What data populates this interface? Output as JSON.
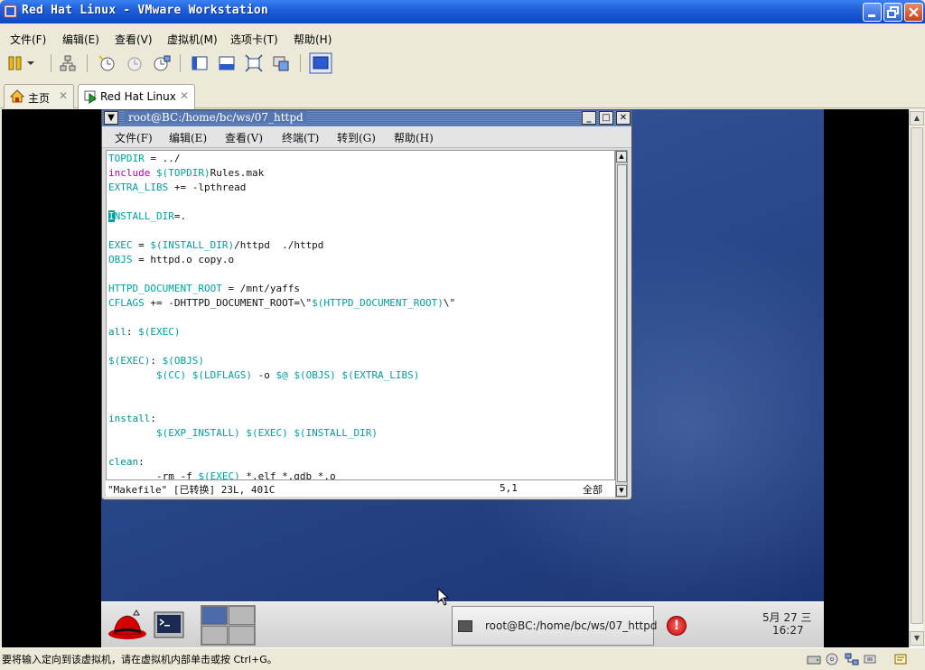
{
  "window": {
    "title": "Red Hat Linux - VMware Workstation"
  },
  "menubar": {
    "items": [
      "文件(F)",
      "编辑(E)",
      "查看(V)",
      "虚拟机(M)",
      "选项卡(T)",
      "帮助(H)"
    ]
  },
  "tabs": [
    {
      "label": "主页",
      "close": "✕"
    },
    {
      "label": "Red Hat Linux",
      "close": "✕"
    }
  ],
  "terminal": {
    "title": "root@BC:/home/bc/ws/07_httpd",
    "menu": [
      "文件(F)",
      "编辑(E)",
      "查看(V)",
      "终端(T)",
      "转到(G)",
      "帮助(H)"
    ],
    "lines": [
      [
        {
          "t": "TOPDIR",
          "c": "c-var"
        },
        {
          "t": " = ../"
        }
      ],
      [
        {
          "t": "include",
          "c": "c-kw"
        },
        {
          "t": " $(TOPDIR)",
          "c": "c-var"
        },
        {
          "t": "Rules.mak"
        }
      ],
      [
        {
          "t": "EXTRA_LIBS",
          "c": "c-var"
        },
        {
          "t": " += -lpthread"
        }
      ],
      [],
      [
        {
          "t": "I",
          "c": "cursor"
        },
        {
          "t": "NSTALL_DIR",
          "c": "c-var"
        },
        {
          "t": "=."
        }
      ],
      [],
      [
        {
          "t": "EXEC",
          "c": "c-var"
        },
        {
          "t": " = "
        },
        {
          "t": "$(INSTALL_DIR)",
          "c": "c-var"
        },
        {
          "t": "/httpd  ./httpd"
        }
      ],
      [
        {
          "t": "OBJS",
          "c": "c-var"
        },
        {
          "t": " = httpd.o copy.o"
        }
      ],
      [],
      [
        {
          "t": "HTTPD_DOCUMENT_ROOT",
          "c": "c-var"
        },
        {
          "t": " = /mnt/yaffs"
        }
      ],
      [
        {
          "t": "CFLAGS",
          "c": "c-var"
        },
        {
          "t": " += -DHTTPD_DOCUMENT_ROOT=\\\""
        },
        {
          "t": "$(HTTPD_DOCUMENT_ROOT)",
          "c": "c-var"
        },
        {
          "t": "\\\""
        }
      ],
      [],
      [
        {
          "t": "all",
          "c": "c-tgt"
        },
        {
          "t": ": "
        },
        {
          "t": "$(EXEC)",
          "c": "c-var"
        }
      ],
      [],
      [
        {
          "t": "$(EXEC)",
          "c": "c-var"
        },
        {
          "t": ": "
        },
        {
          "t": "$(OBJS)",
          "c": "c-var"
        }
      ],
      [
        {
          "t": "        "
        },
        {
          "t": "$(CC)",
          "c": "c-var"
        },
        {
          "t": " "
        },
        {
          "t": "$(LDFLAGS)",
          "c": "c-var"
        },
        {
          "t": " -o "
        },
        {
          "t": "$@",
          "c": "c-var"
        },
        {
          "t": " "
        },
        {
          "t": "$(OBJS)",
          "c": "c-var"
        },
        {
          "t": " "
        },
        {
          "t": "$(EXTRA_LIBS)",
          "c": "c-var"
        }
      ],
      [],
      [],
      [
        {
          "t": "install",
          "c": "c-tgt"
        },
        {
          "t": ":"
        }
      ],
      [
        {
          "t": "        "
        },
        {
          "t": "$(EXP_INSTALL)",
          "c": "c-var"
        },
        {
          "t": " "
        },
        {
          "t": "$(EXEC)",
          "c": "c-var"
        },
        {
          "t": " "
        },
        {
          "t": "$(INSTALL_DIR)",
          "c": "c-var"
        }
      ],
      [],
      [
        {
          "t": "clean",
          "c": "c-tgt"
        },
        {
          "t": ":"
        }
      ],
      [
        {
          "t": "        -rm -f "
        },
        {
          "t": "$(EXEC)",
          "c": "c-var"
        },
        {
          "t": " *.elf *.gdb *.o"
        }
      ]
    ],
    "status": {
      "file": "\"Makefile\" [已转换] 23L, 401C",
      "position": "5,1",
      "scroll": "全部"
    }
  },
  "guest_panel": {
    "task_label": "root@BC:/home/bc/ws/07_httpd",
    "clock_date": "5月 27 三",
    "clock_time": "16:27"
  },
  "statusbar": {
    "message": "要将输入定向到该虚拟机，请在虚拟机内部单击或按 Ctrl+G。"
  },
  "colors": {
    "xp_title_blue": "#0b48c4",
    "xp_face": "#ece9d8",
    "code_variable": "#00a0a0",
    "code_keyword": "#b000b0"
  }
}
